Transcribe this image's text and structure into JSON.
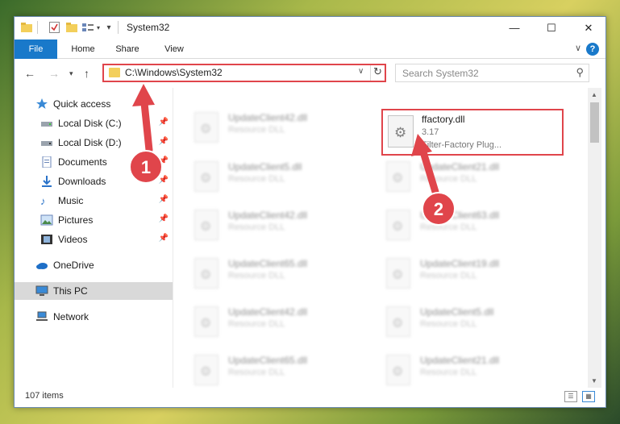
{
  "window": {
    "title": "System32",
    "controls": {
      "minimize": "—",
      "maximize": "☐",
      "close": "✕"
    }
  },
  "ribbon": {
    "tabs": [
      "File",
      "Home",
      "Share",
      "View"
    ],
    "help": "?"
  },
  "navbar": {
    "address": "C:\\Windows\\System32",
    "search_placeholder": "Search System32"
  },
  "sidebar": {
    "items": [
      {
        "label": "Quick access",
        "icon": "star-icon",
        "pinned": false
      },
      {
        "label": "Local Disk (C:)",
        "icon": "drive-icon",
        "pinned": true
      },
      {
        "label": "Local Disk (D:)",
        "icon": "drive-icon",
        "pinned": true
      },
      {
        "label": "Documents",
        "icon": "documents-icon",
        "pinned": true
      },
      {
        "label": "Downloads",
        "icon": "download-icon",
        "pinned": true
      },
      {
        "label": "Music",
        "icon": "music-icon",
        "pinned": true
      },
      {
        "label": "Pictures",
        "icon": "pictures-icon",
        "pinned": true
      },
      {
        "label": "Videos",
        "icon": "videos-icon",
        "pinned": true
      },
      {
        "label": "OneDrive",
        "icon": "cloud-icon",
        "pinned": false
      },
      {
        "label": "This PC",
        "icon": "computer-icon",
        "pinned": false,
        "selected": true
      },
      {
        "label": "Network",
        "icon": "network-icon",
        "pinned": false
      }
    ]
  },
  "files": {
    "highlighted": {
      "name": "ffactory.dll",
      "version": "3.17",
      "description": "Filter-Factory Plug..."
    },
    "left_column": [
      {
        "name": "UpdateClient42.dll",
        "type": "Resource DLL"
      },
      {
        "name": "UpdateClient5.dll",
        "type": "Resource DLL"
      },
      {
        "name": "UpdateClient42.dll",
        "type": "Resource DLL"
      },
      {
        "name": "UpdateClient65.dll",
        "type": "Resource DLL"
      },
      {
        "name": "UpdateClient42.dll",
        "type": "Resource DLL"
      },
      {
        "name": "UpdateClient65.dll",
        "type": "Resource DLL"
      }
    ],
    "right_column": [
      {
        "name": "UpdateClient21.dll",
        "type": "Resource DLL"
      },
      {
        "name": "UpdateClient63.dll",
        "type": "Resource DLL"
      },
      {
        "name": "UpdateClient19.dll",
        "type": "Resource DLL"
      },
      {
        "name": "UpdateClient5.dll",
        "type": "Resource DLL"
      },
      {
        "name": "UpdateClient21.dll",
        "type": "Resource DLL"
      }
    ]
  },
  "status": {
    "item_count": "107 items"
  },
  "annotations": {
    "step1": "1",
    "step2": "2",
    "color": "#e0454b"
  }
}
